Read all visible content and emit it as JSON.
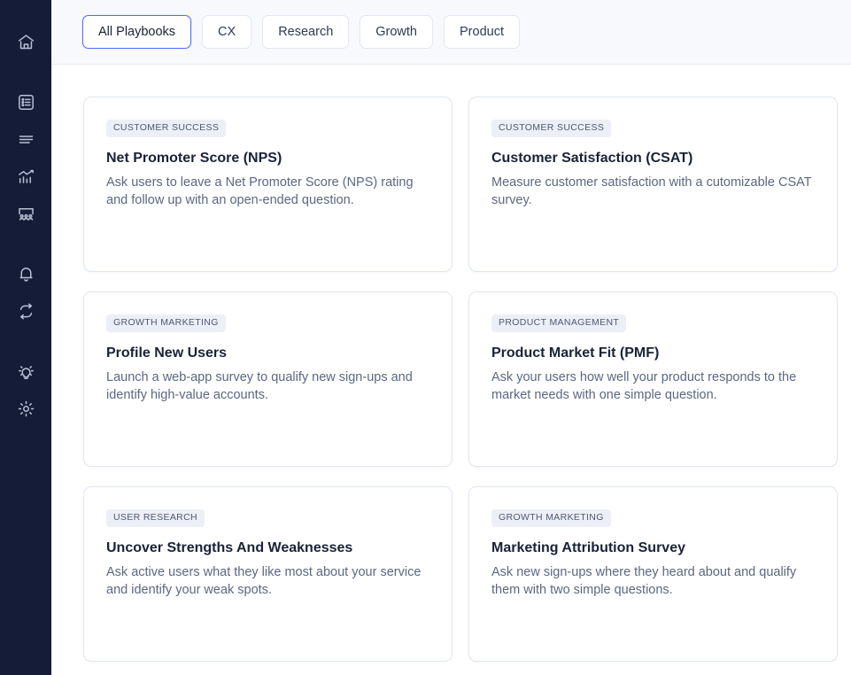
{
  "sidebar": {
    "background_color": "#141C38",
    "icon_color": "#B9C1D6",
    "items": [
      {
        "name": "home",
        "icon": "home-icon",
        "label": "Home"
      },
      {
        "name": "surveys",
        "icon": "list-checklist-icon",
        "label": "Surveys"
      },
      {
        "name": "menu",
        "icon": "menu-lines-icon",
        "label": "Menu"
      },
      {
        "name": "analytics",
        "icon": "chart-trend-icon",
        "label": "Analytics"
      },
      {
        "name": "audience",
        "icon": "audience-people-icon",
        "label": "Audience"
      },
      {
        "name": "notifications",
        "icon": "bell-icon",
        "label": "Notifications"
      },
      {
        "name": "integrations",
        "icon": "sync-arrows-icon",
        "label": "Integrations"
      },
      {
        "name": "ideas",
        "icon": "lightbulb-icon",
        "label": "Ideas"
      },
      {
        "name": "settings",
        "icon": "gear-icon",
        "label": "Settings"
      }
    ]
  },
  "header": {
    "background_color": "#F8F9FD",
    "active_tab_color": "#4F6EF7",
    "tabs": [
      {
        "label": "All Playbooks",
        "active": true
      },
      {
        "label": "CX",
        "active": false
      },
      {
        "label": "Research",
        "active": false
      },
      {
        "label": "Growth",
        "active": false
      },
      {
        "label": "Product",
        "active": false
      }
    ]
  },
  "main": {
    "cards": [
      {
        "badge": "CUSTOMER SUCCESS",
        "title": "Net Promoter Score (NPS)",
        "description": "Ask users to leave a Net Promoter Score (NPS) rating and follow up with an open-ended question."
      },
      {
        "badge": "CUSTOMER SUCCESS",
        "title": "Customer Satisfaction (CSAT)",
        "description": "Measure customer satisfaction with a cutomizable CSAT survey."
      },
      {
        "badge": "GROWTH MARKETING",
        "title": "Profile New Users",
        "description": "Launch a web-app survey to qualify new sign-ups and identify high-value accounts."
      },
      {
        "badge": "PRODUCT MANAGEMENT",
        "title": "Product Market Fit (PMF)",
        "description": "Ask your users how well your product responds to the market needs with one simple question."
      },
      {
        "badge": "USER RESEARCH",
        "title": "Uncover Strengths And Weaknesses",
        "description": "Ask active users what they like most about your service and identify your weak spots."
      },
      {
        "badge": "GROWTH MARKETING",
        "title": "Marketing Attribution Survey",
        "description": "Ask new sign-ups where they heard about and qualify them with two simple questions."
      }
    ]
  }
}
